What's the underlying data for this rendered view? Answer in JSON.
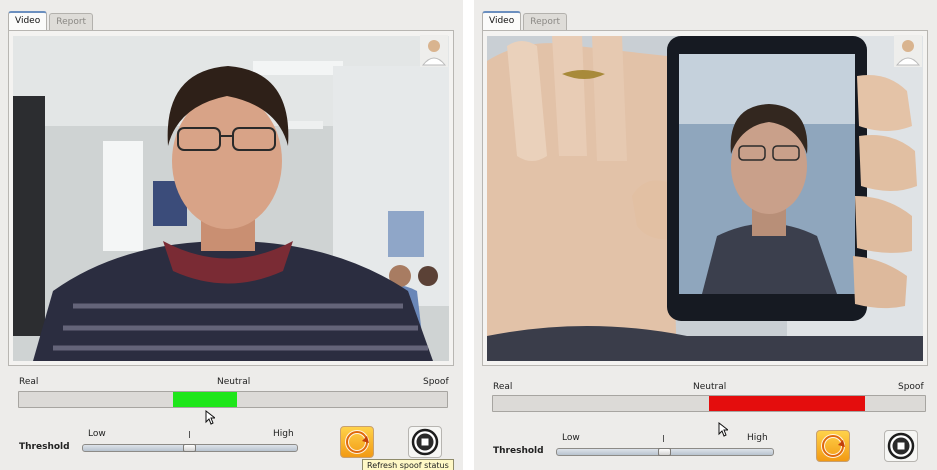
{
  "panels": [
    {
      "tabs": [
        "Video",
        "Report"
      ],
      "meter": {
        "left_label": "Real",
        "center_label": "Neutral",
        "right_label": "Spoof",
        "fill_start": 0.36,
        "fill_end": 0.51,
        "fill_color": "#1ee61a"
      },
      "threshold": {
        "label": "Threshold",
        "low_label": "Low",
        "high_label": "High",
        "value": 0.5
      },
      "tooltip": "Refresh spoof status"
    },
    {
      "tabs": [
        "Video",
        "Report"
      ],
      "meter": {
        "left_label": "Real",
        "center_label": "Neutral",
        "right_label": "Spoof",
        "fill_start": 0.5,
        "fill_end": 0.86,
        "fill_color": "#e40d0d"
      },
      "threshold": {
        "label": "Threshold",
        "low_label": "Low",
        "high_label": "High",
        "value": 0.5
      }
    }
  ],
  "icons": {
    "user": "user-avatar-icon",
    "refresh": "refresh-icon",
    "stop": "stop-icon"
  },
  "colors": {
    "panel_bg": "#edecea",
    "tab_accent": "#6b8fbf",
    "refresh_button": "#f29a14"
  }
}
